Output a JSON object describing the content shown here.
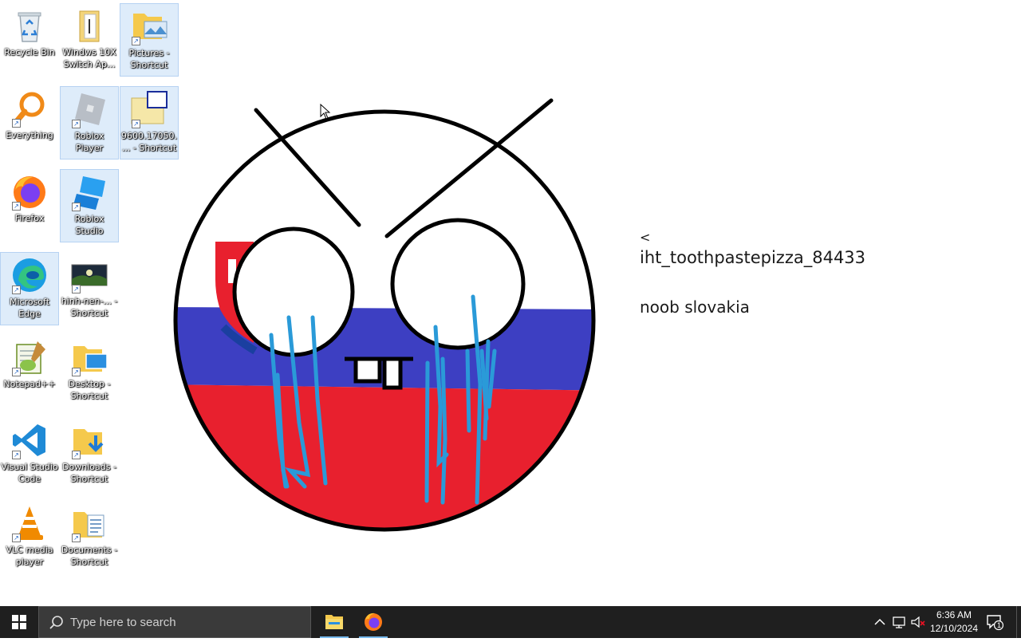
{
  "desktop": {
    "icons": [
      {
        "label": "Recycle Bin",
        "icon": "recycle-bin-icon"
      },
      {
        "label": "Windws 10X Switch Ap...",
        "icon": "file-icon"
      },
      {
        "label": "Pictures - Shortcut",
        "icon": "folder-pictures-icon"
      },
      {
        "label": "Everything",
        "icon": "everything-search-icon"
      },
      {
        "label": "Roblox Player",
        "icon": "roblox-icon"
      },
      {
        "label": "9600.17050.... - Shortcut",
        "icon": "iso-file-icon"
      },
      {
        "label": "Firefox",
        "icon": "firefox-icon"
      },
      {
        "label": "Roblox Studio",
        "icon": "roblox-studio-icon"
      },
      {
        "label": "Microsoft Edge",
        "icon": "edge-icon"
      },
      {
        "label": "hinh-nen-... - Shortcut",
        "icon": "image-file-icon"
      },
      {
        "label": "Notepad++",
        "icon": "notepadpp-icon"
      },
      {
        "label": "Desktop - Shortcut",
        "icon": "folder-desktop-icon"
      },
      {
        "label": "Visual Studio Code",
        "icon": "vscode-icon"
      },
      {
        "label": "Downloads - Shortcut",
        "icon": "folder-downloads-icon"
      },
      {
        "label": "VLC media player",
        "icon": "vlc-icon"
      },
      {
        "label": "Documents - Shortcut",
        "icon": "folder-documents-icon"
      }
    ]
  },
  "wallpaper": {
    "caret": "<",
    "username": "iht_toothpastepizza_84433",
    "note": "noob slovakia",
    "colors": {
      "white": "#ffffff",
      "blue": "#3d3fc2",
      "red": "#e8202e",
      "tears": "#2a9ad8",
      "outline": "#000000"
    }
  },
  "taskbar": {
    "search_placeholder": "Type here to search",
    "pinned": [
      "file-explorer-icon",
      "firefox-icon"
    ],
    "tray": [
      "chevron-up-icon",
      "network-icon",
      "volume-muted-icon"
    ],
    "time": "6:36 AM",
    "date": "12/10/2024",
    "notification_count": "1",
    "colors": {
      "background": "#1f1f1f",
      "search_bg": "#3a3a3a",
      "active_bar": "#76b9ed"
    }
  }
}
